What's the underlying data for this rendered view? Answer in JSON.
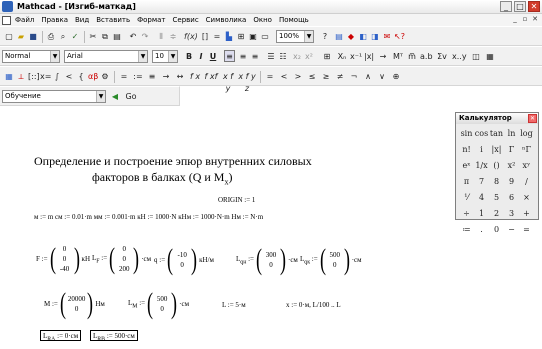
{
  "window": {
    "title": "Mathcad - [Изгиб-маткад]"
  },
  "menu": {
    "items": [
      "Файл",
      "Правка",
      "Вид",
      "Вставить",
      "Формат",
      "Сервис",
      "Символика",
      "Окно",
      "Помощь"
    ]
  },
  "toolbar1": {
    "zoom": "100%"
  },
  "toolbar2": {
    "style": "Normal",
    "font": "Arial",
    "size": "10"
  },
  "toolbar3": {
    "ops": [
      "=",
      ":=",
      "≡",
      "→",
      "↔",
      "f x",
      "f xf",
      "x f y",
      "x f y z"
    ],
    "rel": [
      "=",
      "<",
      ">",
      "≤",
      "≥",
      "≠",
      "¬",
      "∧",
      "∨",
      "⊕"
    ]
  },
  "toolbar4": {
    "resource": "Обучение",
    "go": "Go"
  },
  "calculator": {
    "title": "Калькулятор",
    "keys": [
      "sin",
      "cos",
      "tan",
      "ln",
      "log",
      "n!",
      "i",
      "|x|",
      "Γ",
      "ⁿΓ",
      "eˣ",
      "1/x",
      "()",
      "x²",
      "xʸ",
      "π",
      "7",
      "8",
      "9",
      "/",
      "⅟",
      "4",
      "5",
      "6",
      "×",
      "÷",
      "1",
      "2",
      "3",
      "+",
      "≔",
      ".",
      "0",
      "−",
      "="
    ]
  },
  "worksheet": {
    "heading1": "Определение и построение эпюр внутренних силовых",
    "heading2": "факторов в балках (Q и M",
    "heading2_sub": "x",
    "heading2_end": ")",
    "origin": "ORIGIN := 1",
    "units": "м := m   см := 0.01·m   мм := 0.001·m   кН := 1000·N   кНм := 1000·N·m   Нм := N·m",
    "F_label": "F :=",
    "F_vals": [
      "0",
      "0",
      "-40"
    ],
    "F_unit": "кН",
    "LF_label": "L",
    "LF_sub": "F",
    "LF_vals": [
      "0",
      "0",
      "200"
    ],
    "LF_unit": "·см",
    "q_label": "q :=",
    "q_vals": [
      "-10",
      "0"
    ],
    "q_unit": "кН/м",
    "Lqn_label": "L",
    "Lqn_sub": "qн",
    "Lqn_vals": [
      "300",
      "0"
    ],
    "Lqn_unit": "·см",
    "Lqk_label": "L",
    "Lqk_sub": "qк",
    "Lqk_vals": [
      "500",
      "0"
    ],
    "Lqk_unit": "·см",
    "M_label": "M :=",
    "M_vals": [
      "20000",
      "0"
    ],
    "M_unit": "Нм",
    "LM_label": "L",
    "LM_sub": "M",
    "LM_vals": [
      "500",
      "0"
    ],
    "LM_unit": "·см",
    "L_def": "L := 5·м",
    "x_def": "x := 0·м, L/100 .. L",
    "LRA": "L",
    "LRA_sub": "RA",
    "LRA_val": " := 0·см",
    "LRB": "L",
    "LRB_sub": "RB",
    "LRB_val": " := 500·см"
  }
}
